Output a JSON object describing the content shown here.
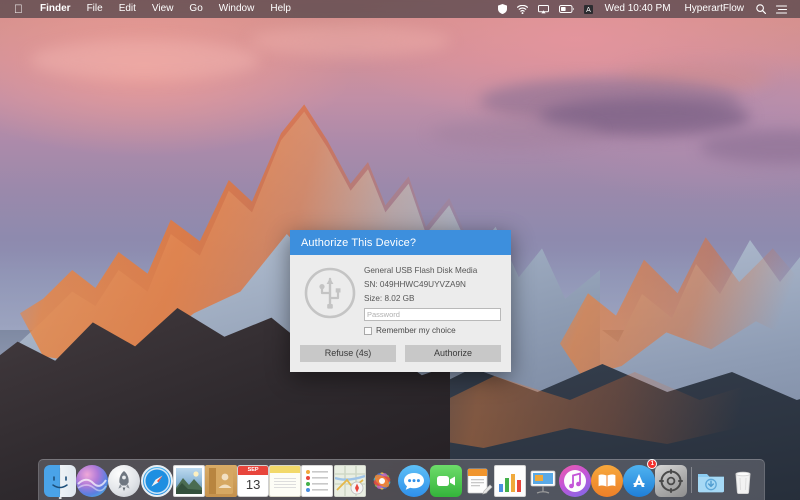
{
  "menubar": {
    "apple_logo": "",
    "app_name": "Finder",
    "items": [
      "File",
      "Edit",
      "View",
      "Go",
      "Window",
      "Help"
    ],
    "status_icons": [
      "shield-icon",
      "wifi-icon",
      "airplay-icon",
      "battery-icon",
      "input-source-icon"
    ],
    "clock": "Wed 10:40 PM",
    "user": "HyperartFlow",
    "right_icons": [
      "search-icon",
      "control-center-icon"
    ]
  },
  "dialog": {
    "title": "Authorize This Device?",
    "device_icon": "usb-icon",
    "device_name": "General USB Flash Disk Media",
    "serial_line": "SN: 049HHWC49UYVZA9N",
    "size_line": "Size: 8.02 GB",
    "password_value": "",
    "password_placeholder": "Password",
    "remember_label": "Remember my choice",
    "remember_checked": false,
    "refuse_label": "Refuse (4s)",
    "authorize_label": "Authorize",
    "title_bar_color": "#3d8fdd",
    "body_color": "#ececec",
    "button_color": "#c8c8c8"
  },
  "dock": {
    "items": [
      {
        "name": "finder",
        "label": "Finder",
        "running": true,
        "badge": ""
      },
      {
        "name": "siri",
        "label": "Siri",
        "running": false,
        "badge": ""
      },
      {
        "name": "launchpad",
        "label": "Launchpad",
        "running": false,
        "badge": ""
      },
      {
        "name": "safari",
        "label": "Safari",
        "running": false,
        "badge": ""
      },
      {
        "name": "photos-preview",
        "label": "Preview",
        "running": false,
        "badge": ""
      },
      {
        "name": "contacts",
        "label": "Contacts",
        "running": false,
        "badge": ""
      },
      {
        "name": "calendar",
        "label": "Calendar",
        "running": false,
        "badge": ""
      },
      {
        "name": "notes",
        "label": "Notes",
        "running": false,
        "badge": ""
      },
      {
        "name": "reminders",
        "label": "Reminders",
        "running": false,
        "badge": ""
      },
      {
        "name": "maps",
        "label": "Maps",
        "running": false,
        "badge": ""
      },
      {
        "name": "photos",
        "label": "Photos",
        "running": false,
        "badge": ""
      },
      {
        "name": "messages",
        "label": "Messages",
        "running": false,
        "badge": ""
      },
      {
        "name": "facetime",
        "label": "FaceTime",
        "running": false,
        "badge": ""
      },
      {
        "name": "pages",
        "label": "Pages",
        "running": false,
        "badge": ""
      },
      {
        "name": "numbers",
        "label": "Numbers",
        "running": false,
        "badge": ""
      },
      {
        "name": "keynote",
        "label": "Keynote",
        "running": false,
        "badge": ""
      },
      {
        "name": "itunes",
        "label": "iTunes",
        "running": false,
        "badge": ""
      },
      {
        "name": "ibooks",
        "label": "iBooks",
        "running": false,
        "badge": ""
      },
      {
        "name": "app-store",
        "label": "App Store",
        "running": false,
        "badge": "1"
      },
      {
        "name": "system-prefs",
        "label": "System Preferences",
        "running": false,
        "badge": ""
      }
    ],
    "right_items": [
      {
        "name": "downloads-folder",
        "label": "Downloads"
      },
      {
        "name": "trash",
        "label": "Trash"
      }
    ],
    "calendar_month": "SEP",
    "calendar_day": "13"
  },
  "desktop": {
    "wallpaper_name": "Sierra"
  }
}
